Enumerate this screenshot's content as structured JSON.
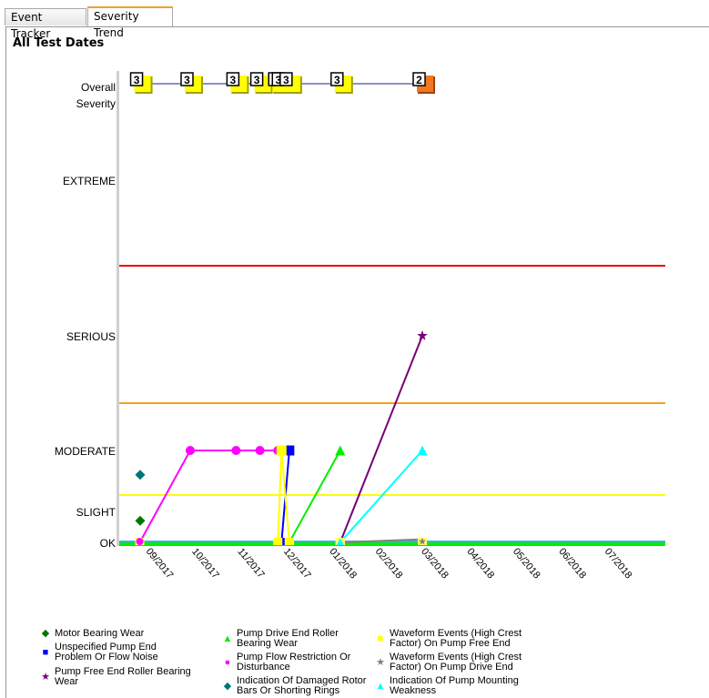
{
  "tabs": [
    {
      "label": "Event Tracker",
      "active": false
    },
    {
      "label": "Severity Trend",
      "active": true
    }
  ],
  "title": "All Test Dates",
  "chart_data": {
    "type": "line",
    "title": "All Test Dates",
    "y_levels": [
      "OK",
      "SLIGHT",
      "MODERATE",
      "SERIOUS",
      "EXTREME"
    ],
    "y_labels": {
      "overall": [
        "Overall",
        "Severity"
      ],
      "ok": "OK",
      "slight": "SLIGHT",
      "moderate": "MODERATE",
      "serious": "SERIOUS",
      "extreme": "EXTREME"
    },
    "x_ticks": [
      "09/2017",
      "10/2017",
      "11/2017",
      "12/2017",
      "01/2018",
      "02/2018",
      "03/2018",
      "04/2018",
      "05/2018",
      "06/2018",
      "07/2018"
    ],
    "x_range_months": [
      0,
      11.5
    ],
    "test_dates": [
      0.15,
      1.25,
      2.25,
      2.77,
      3.16,
      3.24,
      3.41,
      4.52,
      6.31
    ],
    "overall_severity": [
      3,
      3,
      3,
      3,
      3,
      3,
      3,
      3,
      2
    ],
    "overall_severity_colors": {
      "3": "#ffff00",
      "2": "#f07820"
    },
    "thresholds": [
      {
        "name": "extreme-serious",
        "level": 2.6,
        "color": "#ee0000"
      },
      {
        "name": "serious-moderate",
        "level": 1.55,
        "color": "#f5a020"
      },
      {
        "name": "moderate-slight",
        "level": 0.75,
        "color": "#ffff00"
      },
      {
        "name": "ok-upper",
        "level": 0.01,
        "color": "#44aaff"
      },
      {
        "name": "ok-base",
        "level": -0.02,
        "color": "#00ee00"
      }
    ],
    "series": [
      {
        "name": "Motor Bearing Wear",
        "color": "#007700",
        "marker": "diamond",
        "line": false,
        "points": [
          [
            0,
            0.35
          ]
        ]
      },
      {
        "name": "Unspecified Pump End Problem Or Flow Noise",
        "color": "#0000ff",
        "marker": "square",
        "points": [
          [
            3.24,
            0
          ],
          [
            3.41,
            1
          ]
        ]
      },
      {
        "name": "Pump Free End Roller Bearing Wear",
        "color": "#770077",
        "marker": "star",
        "points": [
          [
            4.52,
            0
          ],
          [
            6.31,
            2
          ]
        ]
      },
      {
        "name": "Pump Drive End Roller Bearing Wear",
        "color": "#00ee00",
        "marker": "triangle",
        "points": [
          [
            3.41,
            0
          ],
          [
            4.52,
            1
          ]
        ]
      },
      {
        "name": "Pump Flow Restriction Or Disturbance",
        "color": "#ff00ff",
        "marker": "circle",
        "points": [
          [
            0.15,
            0
          ],
          [
            1.25,
            1
          ],
          [
            2.25,
            1
          ],
          [
            2.77,
            1
          ],
          [
            3.16,
            1
          ]
        ]
      },
      {
        "name": "Indication Of Damaged Rotor Bars Or Shorting Rings",
        "color": "#007777",
        "marker": "diamond",
        "line": false,
        "points": [
          [
            0,
            0.8
          ]
        ]
      },
      {
        "name": "Waveform Events (High Crest Factor) On Pump Free End",
        "color": "#ffff00",
        "marker": "square",
        "points": [
          [
            3.16,
            0
          ],
          [
            3.24,
            1
          ],
          [
            3.41,
            0
          ]
        ]
      },
      {
        "name": "Waveform Events (High Crest Factor) On Pump Drive End",
        "color": "#808080",
        "marker": "star",
        "points": [
          [
            4.52,
            0
          ],
          [
            6.31,
            0.05
          ]
        ]
      },
      {
        "name": "Indication Of Pump Mounting Weakness",
        "color": "#00ffff",
        "marker": "triangle",
        "points": [
          [
            4.52,
            0
          ],
          [
            6.31,
            1
          ]
        ]
      }
    ],
    "legend_position": "bottom"
  },
  "legend": [
    {
      "label": "Motor Bearing Wear",
      "icon": "diamond-icon",
      "color": "#007700",
      "glyph": "◆"
    },
    {
      "label": "Unspecified Pump End Problem Or Flow Noise",
      "icon": "square-icon",
      "color": "#0000ff",
      "glyph": "■"
    },
    {
      "label": "Pump Free End Roller Bearing Wear",
      "icon": "star-icon",
      "color": "#770077",
      "glyph": "★"
    },
    {
      "label": "Pump Drive End Roller Bearing Wear",
      "icon": "triangle-icon",
      "color": "#00ee00",
      "glyph": "▲"
    },
    {
      "label": "Pump Flow Restriction Or Disturbance",
      "icon": "circle-icon",
      "color": "#ff00ff",
      "glyph": "●"
    },
    {
      "label": "Indication Of Damaged Rotor Bars Or Shorting Rings",
      "icon": "diamond-icon",
      "color": "#007777",
      "glyph": "◆"
    },
    {
      "label": "Waveform Events (High Crest Factor) On Pump Free End",
      "icon": "square-icon",
      "color": "#ffff00",
      "glyph": "■"
    },
    {
      "label": "Waveform Events (High Crest Factor) On Pump Drive End",
      "icon": "star-icon",
      "color": "#808080",
      "glyph": "★"
    },
    {
      "label": "Indication Of Pump Mounting Weakness",
      "icon": "triangle-icon",
      "color": "#00ffff",
      "glyph": "▲"
    }
  ]
}
